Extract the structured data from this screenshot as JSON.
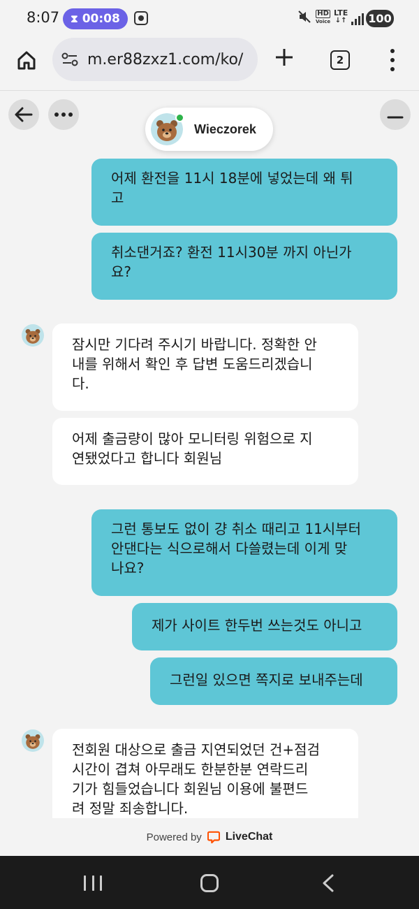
{
  "status_bar": {
    "time": "8:07",
    "timer": "00:08",
    "hd_label": "HD",
    "voice_label": "Voice",
    "lte_label": "LTE",
    "battery": "100"
  },
  "browser": {
    "url": "m.er88zxz1.com/ko/",
    "tab_count": "2"
  },
  "chat": {
    "agent_name": "Wieczorek",
    "messages": [
      {
        "from": "me",
        "lines": [
          "어제 환전을 11시 18분에 넣었는데 왜 튀",
          "고"
        ]
      },
      {
        "from": "me",
        "lines": [
          "취소댄거죠? 환전 11시30분 까지 아닌가",
          "요?"
        ]
      },
      {
        "from": "agent",
        "lines": [
          "잠시만 기다려 주시기 바랍니다. 정확한 안",
          "내를 위해서 확인 후 답변 도움드리겠습니",
          "다."
        ]
      },
      {
        "from": "agent",
        "lines": [
          "어제 출금량이 많아 모니터링 위험으로 지",
          "연됐었다고 합니다 회원님"
        ]
      },
      {
        "from": "me",
        "lines": [
          "그런 통보도 없이 걍 취소 때리고 11시부터",
          "안댄다는 식으로해서 다쓸렸는데 이게 맞",
          "나요?"
        ]
      },
      {
        "from": "me",
        "lines": [
          "제가 사이트 한두번 쓰는것도 아니고"
        ]
      },
      {
        "from": "me",
        "lines": [
          "그런일 있으면 쪽지로 보내주는데"
        ]
      },
      {
        "from": "agent",
        "lines": [
          "전회원 대상으로 출금 지연되었던 건+점검",
          "시간이 겹쳐 아무래도 한분한분 연락드리",
          "기가 힘들었습니다 회원님 이용에 불편드",
          "려 정말 죄송합니다."
        ]
      }
    ]
  },
  "footer": {
    "powered_by": "Powered by",
    "brand": "LiveChat"
  },
  "colors": {
    "my_bubble": "#5ec6d6",
    "agent_bubble": "#ffffff",
    "timer_pill": "#6b62e6",
    "livechat_orange": "#ff5100"
  }
}
